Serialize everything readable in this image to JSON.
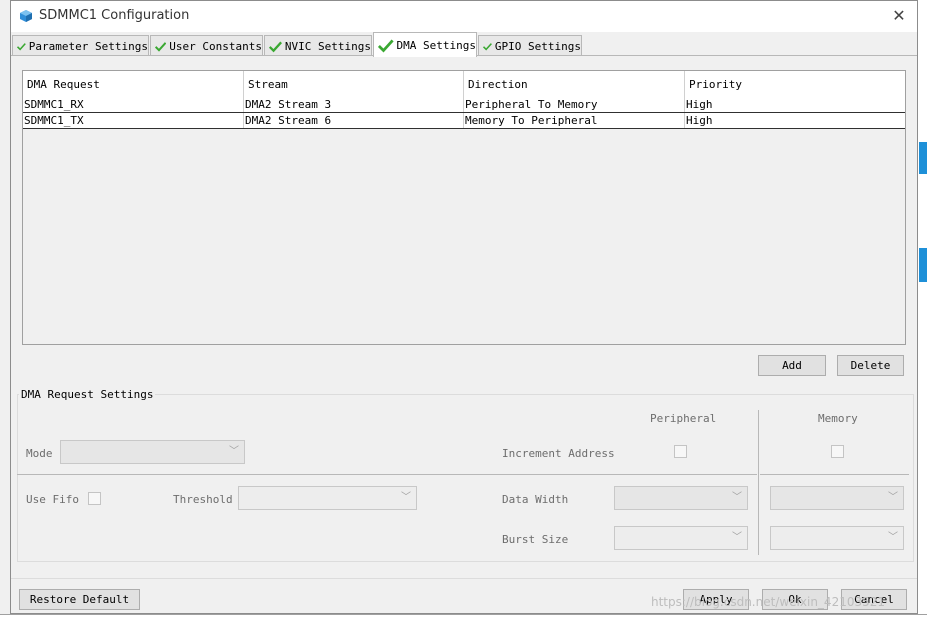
{
  "window": {
    "title": "SDMMC1 Configuration",
    "close_glyph": "✕"
  },
  "tabs": [
    {
      "label": "Parameter Settings"
    },
    {
      "label": "User Constants"
    },
    {
      "label": "NVIC Settings"
    },
    {
      "label": "DMA Settings",
      "active": true
    },
    {
      "label": "GPIO Settings"
    }
  ],
  "table": {
    "columns": [
      "DMA Request",
      "Stream",
      "Direction",
      "Priority"
    ],
    "rows": [
      [
        "SDMMC1_RX",
        "DMA2 Stream 3",
        "Peripheral To Memory",
        "High"
      ],
      [
        "SDMMC1_TX",
        "DMA2 Stream 6",
        "Memory To Peripheral",
        "High"
      ]
    ]
  },
  "buttons": {
    "add": "Add",
    "delete": "Delete",
    "restore": "Restore Default",
    "apply": "Apply",
    "ok": "Ok",
    "cancel": "Cancel"
  },
  "request_settings": {
    "title": "DMA Request Settings",
    "peripheral": "Peripheral",
    "memory": "Memory",
    "mode": "Mode",
    "increment_address": "Increment Address",
    "use_fifo": "Use Fifo",
    "threshold": "Threshold",
    "data_width": "Data Width",
    "burst_size": "Burst Size"
  },
  "watermark": "https://blog.csdn.net/weixin_42103521",
  "colors": {
    "check_green": "#3aa832",
    "accent_blue": "#1e90d8"
  },
  "icons": {
    "tab_status": "green-check-icon",
    "combo_arrow": "chevron-down-icon",
    "window_icon": "cube-app-icon"
  }
}
